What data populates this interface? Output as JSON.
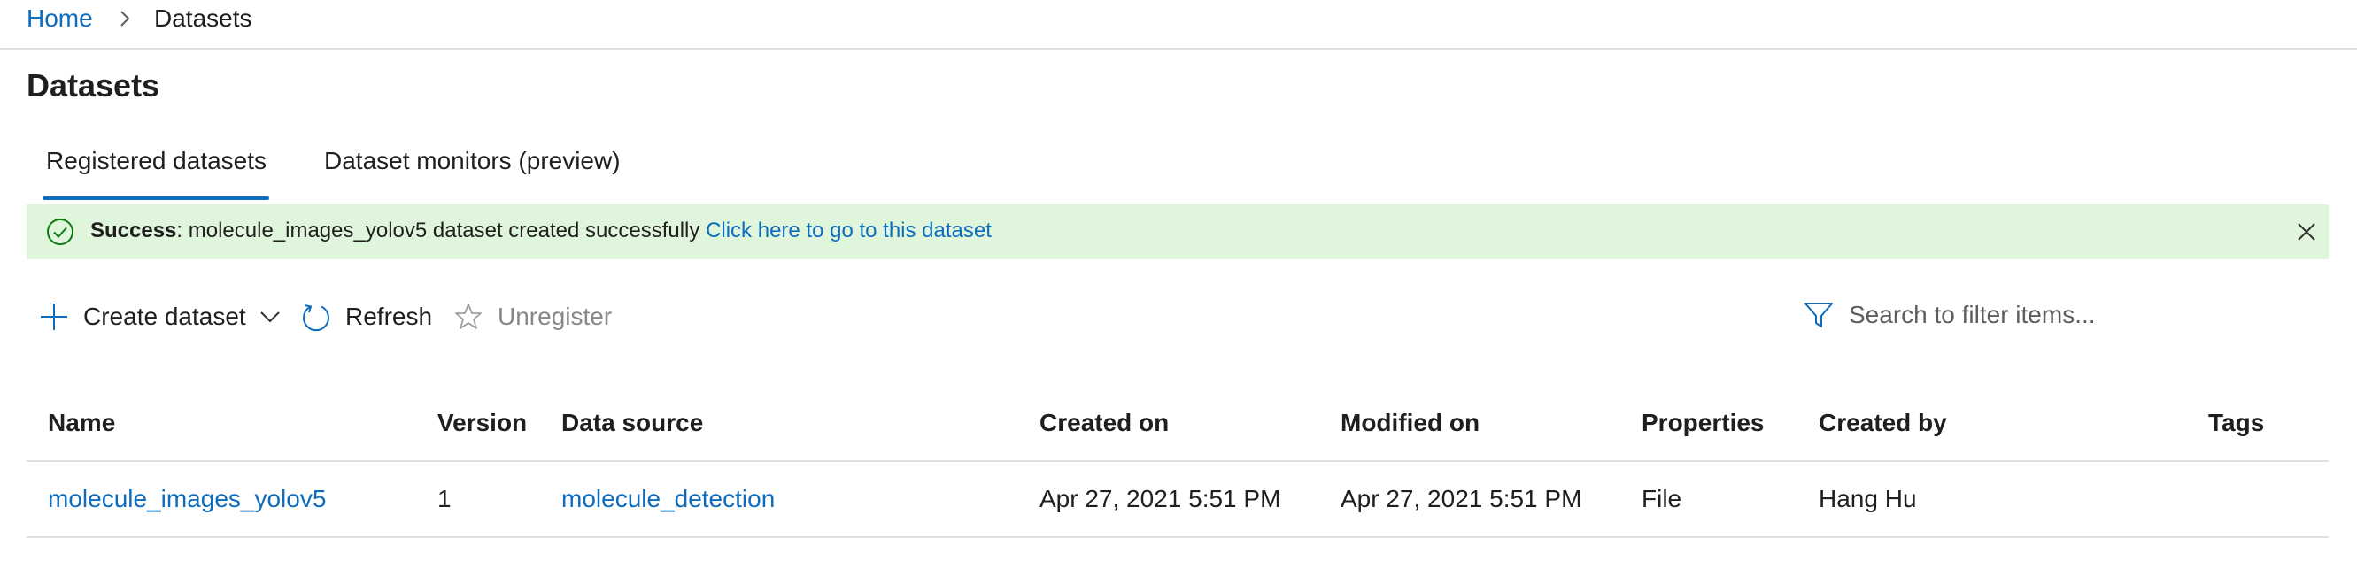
{
  "breadcrumb": {
    "home": "Home",
    "current": "Datasets"
  },
  "page_title": "Datasets",
  "tabs": [
    {
      "label": "Registered datasets",
      "selected": true
    },
    {
      "label": "Dataset monitors (preview)",
      "selected": false
    }
  ],
  "banner": {
    "title": "Success",
    "message": ": molecule_images_yolov5 dataset created successfully ",
    "link": "Click here to go to this dataset"
  },
  "toolbar": {
    "create_label": "Create dataset",
    "refresh_label": "Refresh",
    "unregister_label": "Unregister"
  },
  "search": {
    "placeholder": "Search to filter items..."
  },
  "table": {
    "columns": [
      "Name",
      "Version",
      "Data source",
      "Created on",
      "Modified on",
      "Properties",
      "Created by",
      "Tags"
    ],
    "rows": [
      {
        "name": "molecule_images_yolov5",
        "version": "1",
        "data_source": "molecule_detection",
        "created_on": "Apr 27, 2021 5:51 PM",
        "modified_on": "Apr 27, 2021 5:51 PM",
        "properties": "File",
        "created_by": "Hang Hu",
        "tags": ""
      }
    ]
  },
  "colors": {
    "accent": "#0f6cbd",
    "success_bg": "#dff6dd",
    "success_icon": "#107c10",
    "disabled": "#8a8886"
  },
  "icons": {
    "breadcrumb_separator": "chevron-right-icon",
    "banner": "check-circle-icon",
    "banner_close": "close-icon",
    "create": "plus-icon",
    "create_menu": "chevron-down-icon",
    "refresh": "refresh-icon",
    "unregister": "star-icon",
    "search": "filter-icon"
  }
}
